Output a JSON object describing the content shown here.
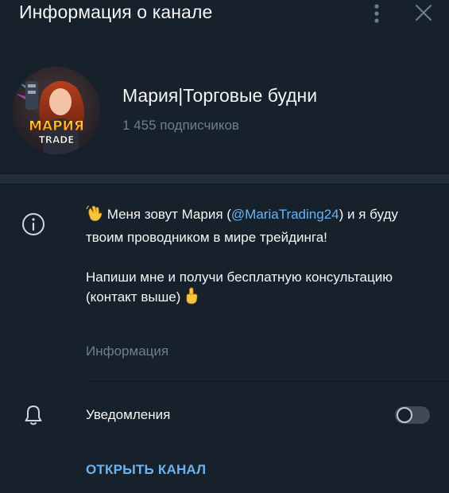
{
  "header": {
    "title": "Информация о канале",
    "menu_icon": "kebab-menu-icon",
    "close_icon": "close-icon"
  },
  "channel": {
    "name": "Мария|Торговые будни",
    "subscribers": "1 455 подписчиков",
    "avatar": {
      "text_top": "МАРИЯ",
      "text_bottom": "TRADE"
    }
  },
  "description": {
    "line1_before": " Меня зовут Мария (",
    "mention": "@MariaTrading24",
    "line1_after": ") и я буду твоим проводником в мире трейдинга!",
    "paragraph2": "Напиши мне и получи бесплатную консультацию (контакт выше) ",
    "caption": "Информация",
    "emoji_start": "waving-hand-emoji",
    "emoji_end": "pointing-up-emoji"
  },
  "notifications": {
    "label": "Уведомления",
    "enabled": false
  },
  "actions": {
    "open_channel": "ОТКРЫТЬ КАНАЛ"
  },
  "colors": {
    "background": "#17212b",
    "separator": "#232e3c",
    "accent": "#6ab3f3",
    "secondary_text": "#6d7f8f",
    "primary_text": "#f5f5f5"
  }
}
